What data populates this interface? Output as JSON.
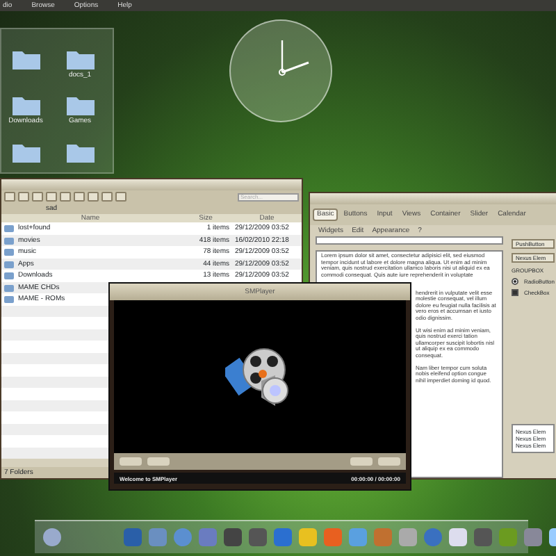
{
  "menu_bar": {
    "items": [
      "dio",
      "Browse",
      "Options",
      "Help"
    ]
  },
  "desktop_folders": [
    {
      "label": "docs_1"
    },
    {
      "label": "Downloads"
    },
    {
      "label": "Games"
    }
  ],
  "file_manager": {
    "search": {
      "placeholder": "Search..."
    },
    "path": "sad",
    "columns": [
      "Name",
      "Size",
      "Date"
    ],
    "rows": [
      {
        "name": "lost+found",
        "size": "1 items",
        "date": "29/12/2009 03:52"
      },
      {
        "name": "movies",
        "size": "418 items",
        "date": "16/02/2010 22:18"
      },
      {
        "name": "music",
        "size": "78 items",
        "date": "29/12/2009 03:52"
      },
      {
        "name": "Apps",
        "size": "44 items",
        "date": "29/12/2009 03:52"
      },
      {
        "name": "Downloads",
        "size": "13 items",
        "date": "29/12/2009 03:52"
      },
      {
        "name": "MAME CHDs"
      },
      {
        "name": "MAME - ROMs"
      }
    ],
    "status": "7 Folders"
  },
  "widget_window": {
    "tabs": [
      {
        "label": "Basic",
        "selected": true
      },
      {
        "label": "Buttons",
        "selected": false
      },
      {
        "label": "Input",
        "selected": false
      },
      {
        "label": "Views",
        "selected": false
      },
      {
        "label": "Container",
        "selected": false
      },
      {
        "label": "Slider",
        "selected": false
      },
      {
        "label": "Calendar",
        "selected": false
      }
    ],
    "menu": [
      "Widgets",
      "Edit",
      "Appearance",
      "?"
    ],
    "paragraphs": [
      "Lorem ipsum dolor sit amet, consectetur adipisici elit, sed eiusmod tempor incidunt ut labore et dolore magna aliqua. Ut enim ad minim veniam, quis nostrud exercitation ullamco laboris nisi ut aliquid ex ea commodi consequat. Quis aute iure reprehenderit in voluptate",
      "hendrerit in vulputate velit esse molestie consequat, vel illum dolore eu feugiat nulla facilisis at vero eros et accumsan et iusto odio dignissim.",
      "Ut wisi enim ad minim veniam, quis nostrud exerci tation ullamcorper suscipit lobortis nisl ut aliquip ex ea commodo consequat.",
      "Nam liber tempor cum soluta nobis eleifend option congue nihil imperdiet doming id quod."
    ],
    "side_buttons": [
      "PushButton",
      "Nexus Elem"
    ],
    "group_title": "GROUPBOX",
    "options": [
      {
        "kind": "radio",
        "label": "RadioButton",
        "checked": true
      },
      {
        "kind": "checkbox",
        "label": "CheckBox",
        "checked": true
      }
    ],
    "tree": [
      "Nexus Elem",
      "Nexus Elem",
      "Nexus Elem"
    ]
  },
  "player": {
    "title": "SMPlayer",
    "status": "Welcome to SMPlayer",
    "time": "00:00:00 / 00:00:00"
  }
}
